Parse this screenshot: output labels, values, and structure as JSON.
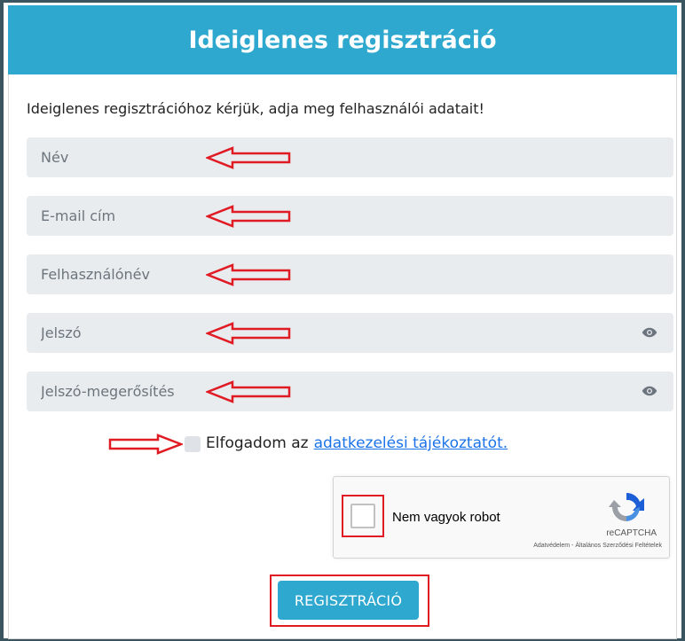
{
  "header": {
    "title": "Ideiglenes regisztráció"
  },
  "intro": "Ideiglenes regisztrációhoz kérjük, adja meg felhasználói adatait!",
  "fields": {
    "name": {
      "placeholder": "Név",
      "value": ""
    },
    "email": {
      "placeholder": "E-mail cím",
      "value": ""
    },
    "username": {
      "placeholder": "Felhasználónév",
      "value": ""
    },
    "password": {
      "placeholder": "Jelszó",
      "value": ""
    },
    "password_confirm": {
      "placeholder": "Jelszó-megerősítés",
      "value": ""
    }
  },
  "terms": {
    "text": "Elfogadom az",
    "link": "adatkezelési tájékoztatót."
  },
  "recaptcha": {
    "label": "Nem vagyok robot",
    "brand": "reCAPTCHA",
    "links": "Adatvédelem - Általános Szerződési Feltételek"
  },
  "submit_label": "REGISZTRÁCIÓ",
  "icons": {
    "eye": "eye-icon",
    "annotation_arrow": "red-outline-arrow",
    "recaptcha_logo": "recaptcha-logo-icon"
  },
  "colors": {
    "accent": "#2fa8cf",
    "annotation": "#e01b24",
    "field_bg": "#e9ecef",
    "link": "#1a73e8"
  }
}
